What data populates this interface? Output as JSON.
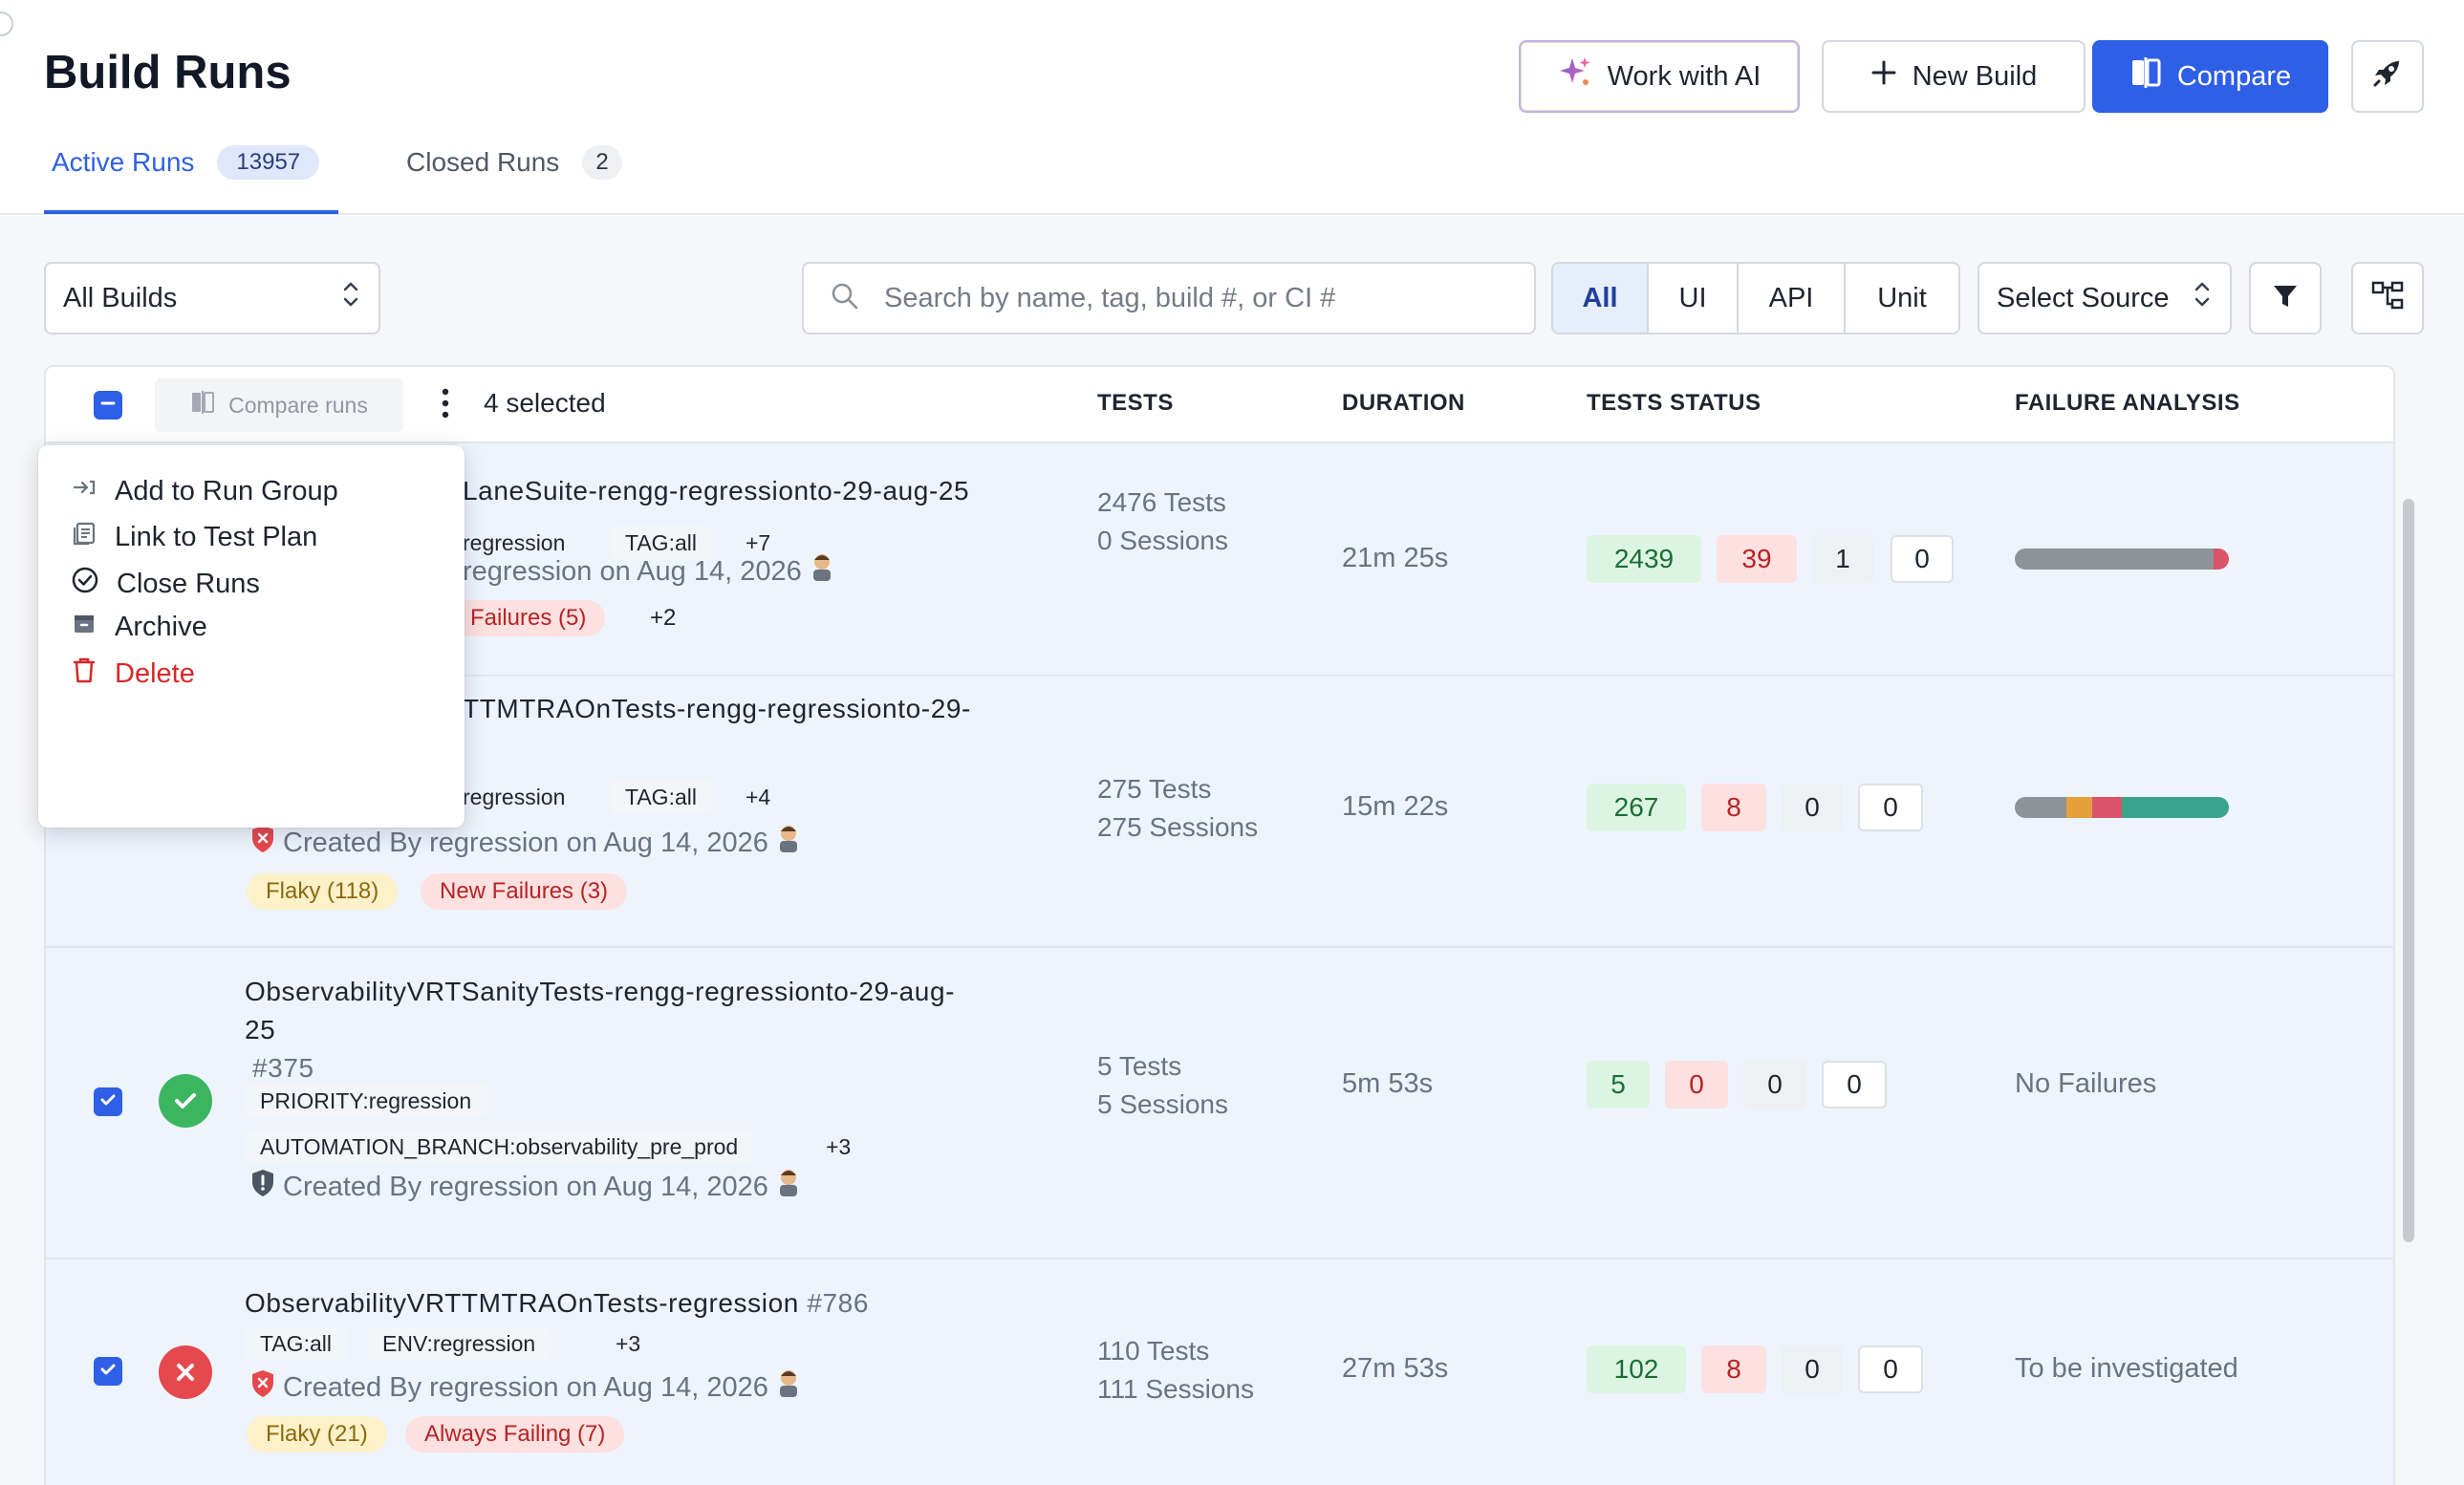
{
  "header": {
    "title": "Build Runs",
    "work_with_ai": "Work with AI",
    "new_build": "New Build",
    "compare": "Compare"
  },
  "tabs": [
    {
      "label": "Active Runs",
      "count": "13957"
    },
    {
      "label": "Closed Runs",
      "count": "2"
    }
  ],
  "filters": {
    "builds_select": "All Builds",
    "search_placeholder": "Search by name, tag, build #, or CI #",
    "type_segments": [
      "All",
      "UI",
      "API",
      "Unit"
    ],
    "source_select": "Select Source"
  },
  "table": {
    "compare_runs": "Compare runs",
    "selected": "4 selected",
    "columns": [
      "TESTS",
      "DURATION",
      "TESTS STATUS",
      "FAILURE ANALYSIS"
    ]
  },
  "menu": {
    "items": [
      "Add to Run Group",
      "Link to Test Plan",
      "Close Runs",
      "Archive",
      "Delete"
    ]
  },
  "rows": [
    {
      "name": "LaneSuite-rengg-regressionto-29-aug-25",
      "tags": [
        "regression",
        "TAG:all",
        "+7"
      ],
      "created": "regression on Aug 14, 2026",
      "badges": [
        "Failures (5)",
        "+2"
      ],
      "tests": "2476 Tests",
      "sessions": "0 Sessions",
      "duration": "21m 25s",
      "status": [
        "2439",
        "39",
        "1",
        "0"
      ],
      "failure_bar": [
        {
          "color": "#8e9299",
          "pct": 93
        },
        {
          "color": "#d9536b",
          "pct": 7
        }
      ]
    },
    {
      "name": "TTMTRAOnTests-rengg-regressionto-29-",
      "tags": [
        "regression",
        "TAG:all",
        "+4"
      ],
      "created": "Created By regression on Aug 14, 2026",
      "badges": [
        "Flaky (118)",
        "New Failures (3)"
      ],
      "tests": "275 Tests",
      "sessions": "275 Sessions",
      "duration": "15m 22s",
      "status": [
        "267",
        "8",
        "0",
        "0"
      ],
      "failure_bar": [
        {
          "color": "#8e9299",
          "pct": 24
        },
        {
          "color": "#e4a03a",
          "pct": 12
        },
        {
          "color": "#d9536b",
          "pct": 14
        },
        {
          "color": "#3aa38b",
          "pct": 50
        }
      ]
    },
    {
      "name_line1": "ObservabilityVRTSanityTests-rengg-regressionto-29-aug-",
      "name_line2": "25",
      "number": "#375",
      "tags": [
        "PRIORITY:regression",
        "AUTOMATION_BRANCH:observability_pre_prod",
        "+3"
      ],
      "created": "Created By regression on Aug 14, 2026",
      "tests": "5 Tests",
      "sessions": "5 Sessions",
      "duration": "5m 53s",
      "status": [
        "5",
        "0",
        "0",
        "0"
      ],
      "failure_text": "No Failures"
    },
    {
      "name": "ObservabilityVRTTMTRAOnTests-regression",
      "number": "#786",
      "tags": [
        "TAG:all",
        "ENV:regression",
        "+3"
      ],
      "created": "Created By regression on Aug 14, 2026",
      "badges": [
        "Flaky (21)",
        "Always Failing (7)"
      ],
      "tests": "110 Tests",
      "sessions": "111 Sessions",
      "duration": "27m 53s",
      "status": [
        "102",
        "8",
        "0",
        "0"
      ],
      "failure_text": "To be investigated"
    }
  ],
  "colors": {
    "accent": "#2f5fe6",
    "pass": "#1b6e34",
    "fail": "#b62424",
    "success_icon": "#3cb561",
    "error_icon": "#e5484d"
  }
}
